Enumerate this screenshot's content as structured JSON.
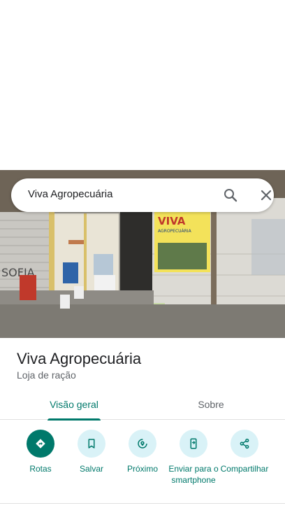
{
  "search": {
    "query": "Viva Agropecuária"
  },
  "photo": {
    "sign_title": "VIVA",
    "sign_subtitle": "AGROPECUÁRIA",
    "wall_text": "SOFIA"
  },
  "place": {
    "name": "Viva Agropecuária",
    "category": "Loja de ração"
  },
  "tabs": [
    {
      "label": "Visão geral",
      "selected": true
    },
    {
      "label": "Sobre",
      "selected": false
    }
  ],
  "actions": [
    {
      "label": "Rotas",
      "icon": "directions-icon"
    },
    {
      "label": "Salvar",
      "icon": "bookmark-icon"
    },
    {
      "label": "Próximo",
      "icon": "nearby-icon"
    },
    {
      "label": "Enviar para o smartphone",
      "icon": "send-to-phone-icon"
    },
    {
      "label": "Compartilhar",
      "icon": "share-icon"
    }
  ],
  "colors": {
    "accent": "#00796b",
    "action_bg": "#d9f2f7",
    "text_primary": "#202124",
    "text_secondary": "#5f6368"
  }
}
